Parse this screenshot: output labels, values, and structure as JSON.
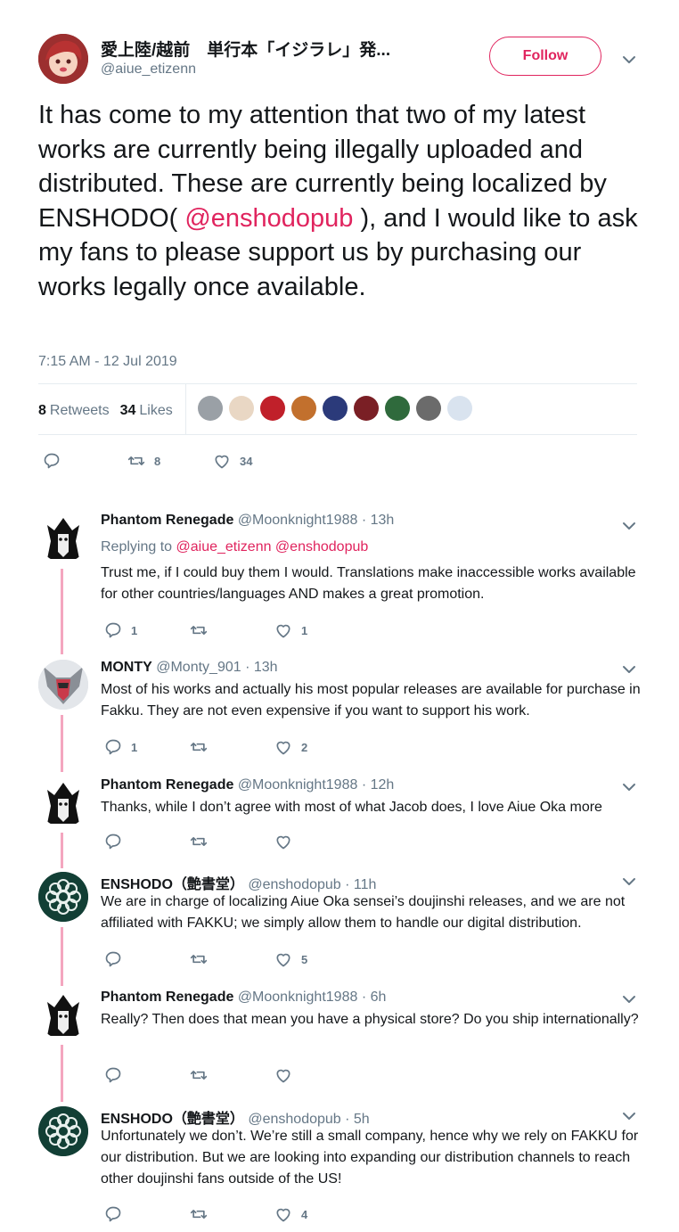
{
  "tweet": {
    "author_name": "愛上陸/越前　単行本「イジラレ」発...",
    "author_handle": "@aiue_etizenn",
    "follow_label": "Follow",
    "text_before": "It has come to my attention that two of my latest works are currently being illegally uploaded and distributed. These are currently being localized by ENSHODO( ",
    "text_mention": "@enshodopub",
    "text_after": " ), and I would like to ask my fans to please support us by purchasing our works legally once available.",
    "timestamp": "7:15 AM - 12 Jul 2019",
    "retweets_count": "8",
    "retweets_label": "Retweets",
    "likes_count": "34",
    "likes_label": "Likes",
    "action_retweets": "8",
    "action_likes": "34"
  },
  "replies": [
    {
      "name": "Phantom Renegade",
      "handle": "@Moonknight1988 · 13h",
      "replying_label": "Replying to",
      "replying_to": "@aiue_etizenn @enshodopub",
      "text": "Trust me, if I could buy them I would. Translations make inaccessible works available for other countries/languages AND makes a great promotion.",
      "replies": "1",
      "retweets": "",
      "likes": "1"
    },
    {
      "name": "MONTY",
      "handle": "@Monty_901 · 13h",
      "text": "Most of his works and actually his most popular releases are available for purchase in Fakku. They are not even expensive if you want to support his work.",
      "replies": "1",
      "retweets": "",
      "likes": "2"
    },
    {
      "name": "Phantom Renegade",
      "handle": "@Moonknight1988 · 12h",
      "text": "Thanks, while I don’t agree with most of what Jacob does, I love Aiue Oka more",
      "replies": "",
      "retweets": "",
      "likes": ""
    },
    {
      "name": "ENSHODO（艶書堂）",
      "handle": "@enshodopub · 11h",
      "text": "We are in charge of localizing Aiue Oka sensei’s doujinshi releases, and we are not affiliated with FAKKU; we simply allow them to handle our digital distribution.",
      "replies": "",
      "retweets": "",
      "likes": "5"
    },
    {
      "name": "Phantom Renegade",
      "handle": "@Moonknight1988 · 6h",
      "text": "Really? Then does that mean you have a physical store? Do you ship internationally?",
      "replies": "",
      "retweets": "",
      "likes": ""
    },
    {
      "name": "ENSHODO（艶書堂）",
      "handle": "@enshodopub · 5h",
      "text": "Unfortunately we don’t. We’re still a small company, hence why we rely on FAKKU for our distribution. But we are looking into expanding our distribution channels to reach other doujinshi fans outside of the US!",
      "replies": "",
      "retweets": "",
      "likes": "4"
    }
  ],
  "colors": {
    "accent": "#e0245e",
    "muted": "#657786",
    "thread_line": "#f4a6bf"
  }
}
